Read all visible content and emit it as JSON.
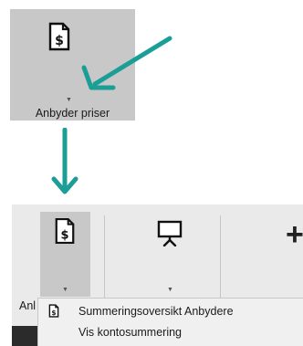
{
  "callout_button": {
    "label": "Anbyder priser",
    "icon": "dollar-document-icon",
    "dropdown_icon": "caret-down-icon"
  },
  "ribbon": {
    "buttons": [
      {
        "icon": "dollar-document-icon",
        "label": "Anl",
        "state": "pressed"
      },
      {
        "icon": "presentation-board-icon",
        "label": ""
      },
      {
        "icon": "plus-icon",
        "label": ""
      }
    ]
  },
  "dropdown_menu": {
    "items": [
      {
        "label": "Summeringsoversikt Anbydere",
        "icon": "dollar-document-icon"
      },
      {
        "label": "Vis kontosummering",
        "icon": ""
      }
    ]
  },
  "colors": {
    "arrow": "#1a9e96",
    "pressed_bg": "#c8c8c8",
    "ribbon_bg": "#eaeaea",
    "menu_bg": "#f0f0f0"
  }
}
